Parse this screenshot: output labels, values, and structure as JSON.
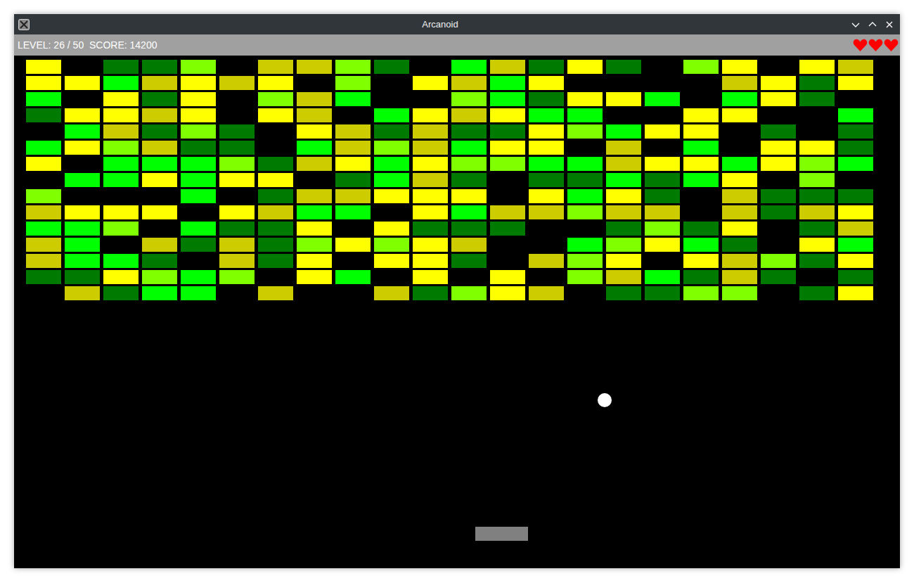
{
  "window": {
    "title": "Arcanoid"
  },
  "status_bar": {
    "text": "LEVEL: 26 / 50  SCORE: 14200",
    "lives": 3
  },
  "bricks": [
    [
      "#ffff00",
      null,
      "#007a00",
      "#007a00",
      "#80ff00",
      null,
      "#cccc00",
      "#cccc00",
      "#80ff00",
      "#007a00",
      null,
      "#00ff00",
      "#cccc00",
      "#007a00",
      "#ffff00",
      "#007a00",
      null,
      "#80ff00",
      "#ffff00",
      null,
      "#ffff00",
      "#cccc00"
    ],
    [
      "#ffff00",
      "#ffff00",
      "#00ff00",
      "#cccc00",
      "#ffff00",
      "#cccc00",
      "#ffff00",
      null,
      "#80ff00",
      null,
      "#ffff00",
      "#cccc00",
      "#00ff00",
      "#ffff00",
      null,
      null,
      null,
      null,
      "#cccc00",
      "#ffff00",
      "#007a00",
      "#ffff00"
    ],
    [
      "#00ff00",
      null,
      "#ffff00",
      "#007a00",
      "#ffff00",
      null,
      "#80ff00",
      "#cccc00",
      "#00ff00",
      null,
      null,
      "#80ff00",
      "#00ff00",
      "#007a00",
      "#ffff00",
      "#ffff00",
      "#00ff00",
      null,
      "#00ff00",
      "#ffff00",
      "#007a00",
      null
    ],
    [
      "#007a00",
      "#ffff00",
      "#ffff00",
      "#cccc00",
      "#ffff00",
      null,
      "#ffff00",
      "#cccc00",
      null,
      "#00ff00",
      "#ffff00",
      "#cccc00",
      "#ffff00",
      "#00ff00",
      "#00ff00",
      null,
      null,
      "#ffff00",
      "#ffff00",
      null,
      null,
      "#00ff00"
    ],
    [
      null,
      "#00ff00",
      "#cccc00",
      "#007a00",
      "#80ff00",
      "#007a00",
      null,
      "#ffff00",
      "#cccc00",
      "#007a00",
      "#cccc00",
      "#007a00",
      "#007a00",
      "#ffff00",
      "#80ff00",
      "#00ff00",
      "#ffff00",
      "#ffff00",
      null,
      "#007a00",
      null,
      "#007a00"
    ],
    [
      "#00ff00",
      "#ffff00",
      "#80ff00",
      "#cccc00",
      "#007a00",
      "#007a00",
      null,
      "#00ff00",
      "#cccc00",
      "#80ff00",
      "#cccc00",
      "#00ff00",
      "#ffff00",
      "#ffff00",
      null,
      "#cccc00",
      null,
      "#00ff00",
      null,
      "#ffff00",
      "#ffff00",
      "#007a00"
    ],
    [
      "#ffff00",
      null,
      "#00ff00",
      "#00ff00",
      "#00ff00",
      "#80ff00",
      "#007a00",
      "#cccc00",
      "#ffff00",
      "#00ff00",
      "#ffff00",
      "#80ff00",
      "#80ff00",
      "#00ff00",
      "#00ff00",
      "#cccc00",
      "#ffff00",
      "#ffff00",
      "#00ff00",
      "#ffff00",
      "#80ff00",
      "#00ff00"
    ],
    [
      null,
      "#00ff00",
      "#00ff00",
      "#ffff00",
      "#00ff00",
      "#ffff00",
      "#ffff00",
      null,
      "#007a00",
      "#00ff00",
      "#cccc00",
      "#007a00",
      null,
      "#007a00",
      "#007a00",
      "#00ff00",
      "#007a00",
      "#00ff00",
      "#ffff00",
      null,
      "#80ff00",
      null
    ],
    [
      "#80ff00",
      null,
      null,
      null,
      "#00ff00",
      null,
      "#007a00",
      "#cccc00",
      "#cccc00",
      "#ffff00",
      "#ffff00",
      "#ffff00",
      null,
      "#ffff00",
      "#00ff00",
      "#ffff00",
      "#007a00",
      null,
      "#cccc00",
      "#007a00",
      "#007a00",
      "#007a00"
    ],
    [
      "#cccc00",
      "#ffff00",
      "#ffff00",
      "#ffff00",
      null,
      "#ffff00",
      "#cccc00",
      "#00ff00",
      "#00ff00",
      null,
      "#ffff00",
      "#00ff00",
      "#cccc00",
      "#cccc00",
      "#80ff00",
      "#cccc00",
      "#cccc00",
      null,
      "#cccc00",
      "#007a00",
      "#cccc00",
      "#ffff00"
    ],
    [
      "#00ff00",
      "#00ff00",
      "#80ff00",
      null,
      "#00ff00",
      "#007a00",
      "#007a00",
      "#ffff00",
      null,
      "#ffff00",
      "#007a00",
      "#007a00",
      "#007a00",
      null,
      null,
      "#007a00",
      "#80ff00",
      "#007a00",
      "#ffff00",
      null,
      "#007a00",
      "#cccc00"
    ],
    [
      "#cccc00",
      "#00ff00",
      null,
      "#cccc00",
      "#007a00",
      "#cccc00",
      "#007a00",
      "#80ff00",
      "#ffff00",
      "#80ff00",
      "#ffff00",
      "#cccc00",
      null,
      null,
      "#00ff00",
      "#80ff00",
      "#ffff00",
      "#00ff00",
      "#007a00",
      null,
      "#ffff00",
      "#00ff00"
    ],
    [
      "#cccc00",
      "#00ff00",
      "#00ff00",
      "#007a00",
      null,
      "#cccc00",
      "#007a00",
      "#ffff00",
      null,
      "#ffff00",
      "#ffff00",
      "#007a00",
      null,
      "#cccc00",
      "#80ff00",
      "#ffff00",
      null,
      "#ffff00",
      "#cccc00",
      "#80ff00",
      "#007a00",
      "#ffff00"
    ],
    [
      "#007a00",
      "#007a00",
      "#ffff00",
      "#80ff00",
      "#00ff00",
      "#80ff00",
      null,
      "#ffff00",
      "#00ff00",
      null,
      "#ffff00",
      null,
      "#ffff00",
      null,
      "#80ff00",
      "#cccc00",
      "#00ff00",
      "#007a00",
      "#cccc00",
      "#007a00",
      null,
      "#007a00"
    ],
    [
      null,
      "#cccc00",
      "#007a00",
      "#00ff00",
      "#00ff00",
      null,
      "#cccc00",
      null,
      null,
      "#cccc00",
      "#007a00",
      "#80ff00",
      "#ffff00",
      "#cccc00",
      null,
      "#007a00",
      "#007a00",
      "#80ff00",
      "#80ff00",
      null,
      "#007a00",
      "#ffff00"
    ]
  ]
}
